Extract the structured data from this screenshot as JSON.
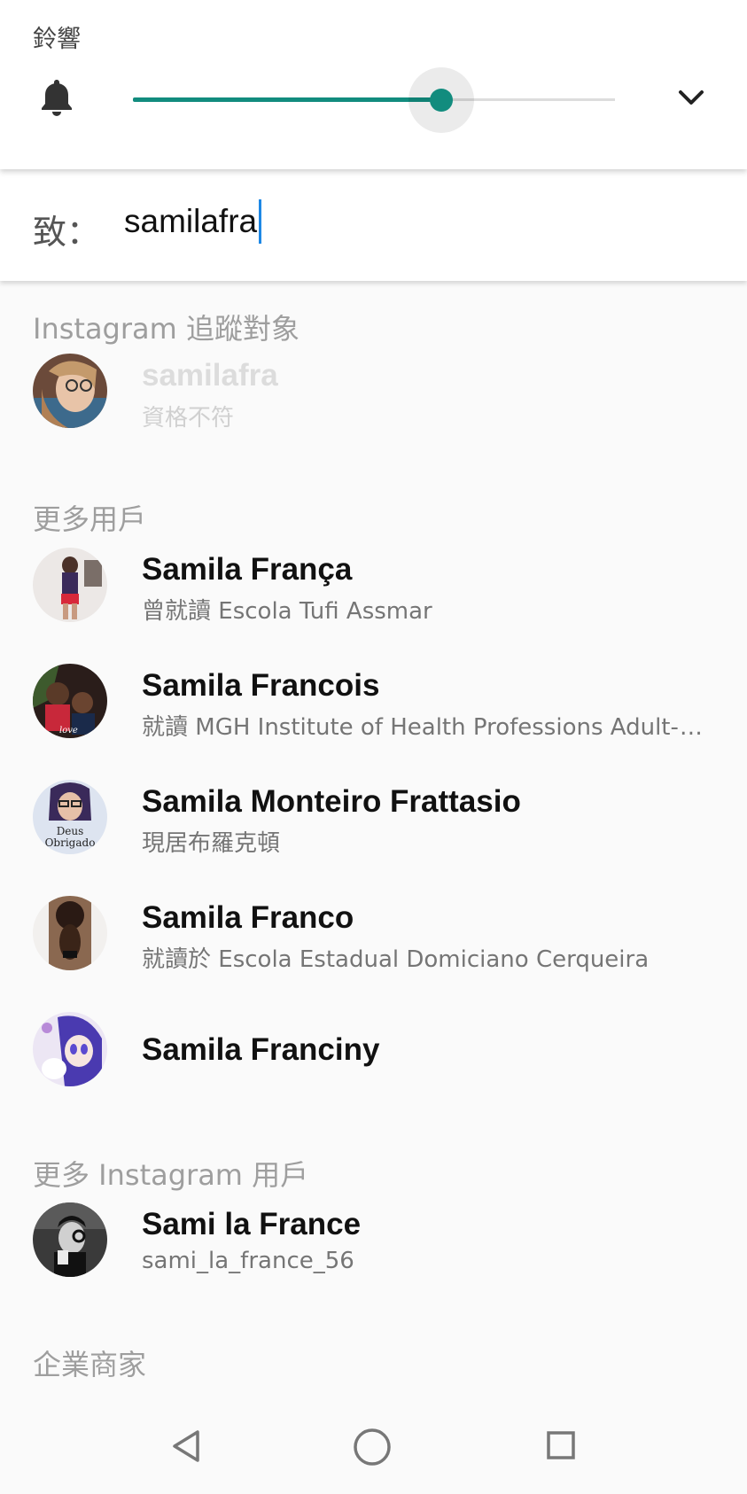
{
  "volume_panel": {
    "title": "鈴響",
    "icon": "bell-icon",
    "level": 0.64,
    "accent_color": "#128c7e",
    "expand_icon": "chevron-down-icon"
  },
  "to_field": {
    "label": "致：",
    "value": "samilafra",
    "caret_color": "#1e88e5"
  },
  "sections": {
    "instagram_following": "Instagram 追蹤對象",
    "more_users": "更多用戶",
    "more_instagram_users": "更多 Instagram 用戶",
    "businesses": "企業商家"
  },
  "instagram_following": [
    {
      "name": "samilafra",
      "sub": "資格不符",
      "disabled": true
    }
  ],
  "more_users": [
    {
      "name": "Samila França",
      "sub": "曾就讀 Escola Tufi Assmar"
    },
    {
      "name": "Samila Francois",
      "sub": "就讀 MGH Institute of Health Professions Adult-G…"
    },
    {
      "name": "Samila Monteiro Frattasio",
      "sub": "現居布羅克頓",
      "avatar_text_1": "Deus",
      "avatar_text_2": "Obrigado"
    },
    {
      "name": "Samila Franco",
      "sub": "就讀於 Escola Estadual Domiciano Cerqueira"
    },
    {
      "name": "Samila Franciny",
      "sub": ""
    }
  ],
  "more_instagram_users": [
    {
      "name": "Sami la France",
      "sub": "sami_la_france_56"
    }
  ],
  "navbar": {
    "back": "back-triangle-icon",
    "home": "home-circle-icon",
    "recents": "recents-square-icon"
  }
}
